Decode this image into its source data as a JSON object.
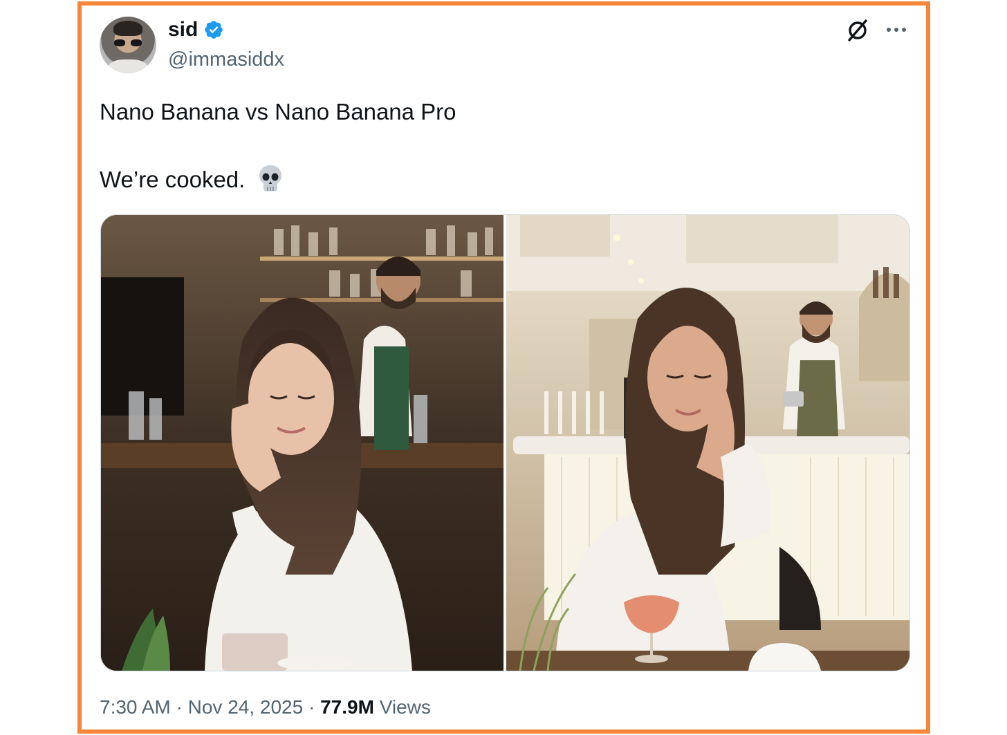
{
  "tweet": {
    "author": {
      "name": "sid",
      "handle": "@immasiddx",
      "verified": true,
      "avatar_icon": "avatar"
    },
    "text_line1": "Nano Banana vs Nano Banana Pro",
    "text_line2": "We’re cooked.",
    "emoji": "skull-emoji",
    "media": [
      {
        "label": "image-left",
        "alt": ""
      },
      {
        "label": "image-right",
        "alt": ""
      }
    ],
    "time": "7:30 AM",
    "date": "Nov 24, 2025",
    "separator": "·",
    "views_count": "77.9M",
    "views_label": "Views"
  },
  "icons": {
    "verified": "verified-badge-icon",
    "grok": "grok-icon",
    "more": "more-options-icon"
  },
  "colors": {
    "frame_border": "#f5873a",
    "verified_blue": "#1d9bf0",
    "text_primary": "#0f1419",
    "text_secondary": "#536471"
  }
}
